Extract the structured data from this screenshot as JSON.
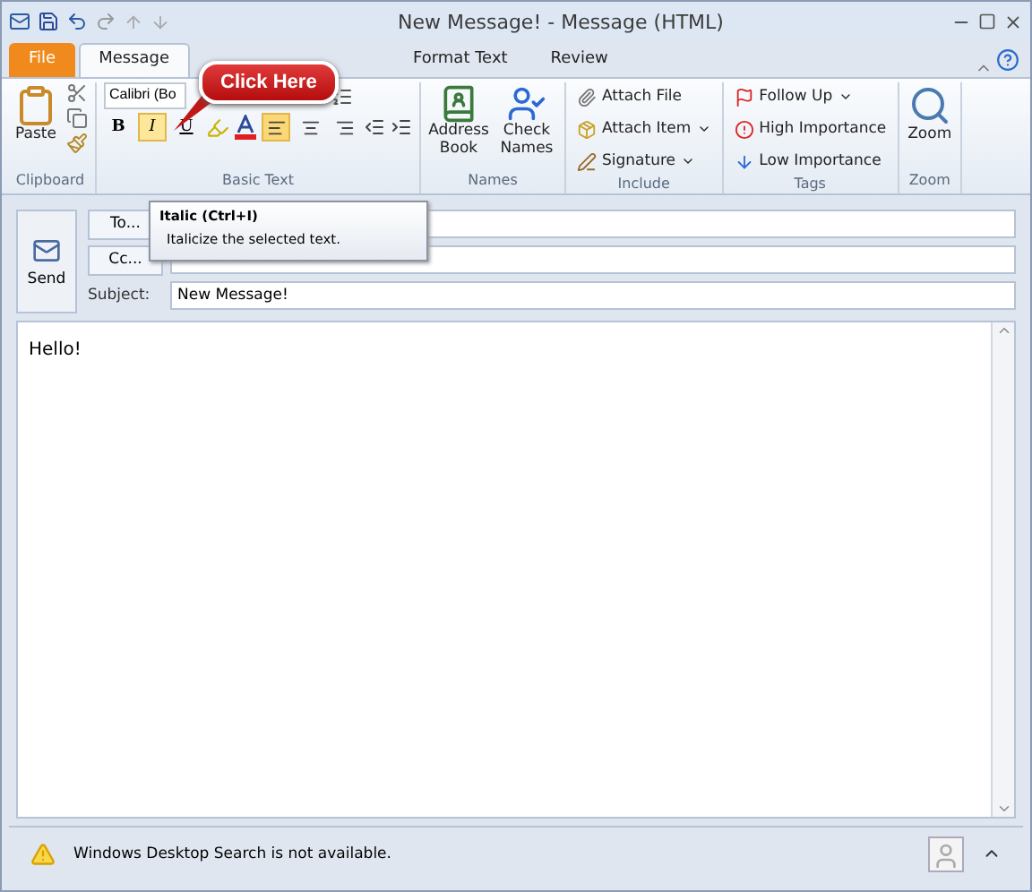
{
  "window": {
    "title": "New Message! - Message (HTML)"
  },
  "tabs": [
    {
      "label": "File",
      "kind": "file",
      "selected": false
    },
    {
      "label": "Message",
      "kind": "tab",
      "selected": true
    },
    {
      "label": "Format Text",
      "kind": "tab",
      "selected": false
    },
    {
      "label": "Review",
      "kind": "tab",
      "selected": false
    }
  ],
  "clipboard": {
    "paste": "Paste",
    "group": "Clipboard"
  },
  "basic_text": {
    "font": "Calibri (Bo",
    "group": "Basic Text",
    "format_buttons": [
      {
        "label": "B",
        "kind": "bold",
        "active": false
      },
      {
        "label": "I",
        "kind": "italic",
        "active": true
      },
      {
        "label": "U",
        "kind": "underline",
        "active": false
      }
    ],
    "align": [
      {
        "kind": "left",
        "selected": true
      },
      {
        "kind": "center",
        "selected": false
      },
      {
        "kind": "right",
        "selected": false
      }
    ]
  },
  "names": {
    "group": "Names",
    "buttons": [
      {
        "label": "Address Book",
        "kind": "book"
      },
      {
        "label": "Check Names",
        "kind": "check"
      }
    ]
  },
  "include": {
    "group": "Include",
    "items": [
      {
        "label": "Attach File",
        "kind": "clip",
        "dropdown": false
      },
      {
        "label": "Attach Item",
        "kind": "item",
        "dropdown": true
      },
      {
        "label": "Signature",
        "kind": "pen",
        "dropdown": true
      }
    ]
  },
  "tags": {
    "group": "Tags",
    "items": [
      {
        "label": "Follow Up",
        "kind": "flag",
        "dropdown": true
      },
      {
        "label": "High Importance",
        "kind": "high",
        "dropdown": false
      },
      {
        "label": "Low Importance",
        "kind": "low",
        "dropdown": false
      }
    ]
  },
  "zoom": {
    "label": "Zoom",
    "group": "Zoom"
  },
  "callout": "Click Here",
  "tooltip": {
    "title": "Italic (Ctrl+I)",
    "text": "Italicize the selected text."
  },
  "header": {
    "send": "Send",
    "to": "To...",
    "cc": "Cc...",
    "subject_label": "Subject:",
    "subject": "New Message!"
  },
  "body": "Hello!",
  "status": "Windows Desktop Search is not available."
}
